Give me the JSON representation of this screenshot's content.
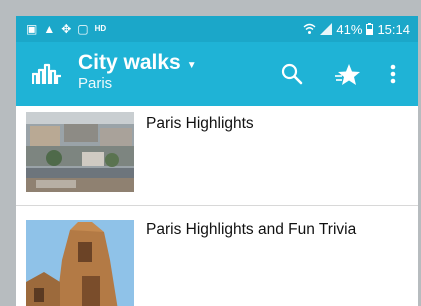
{
  "status_bar": {
    "left_icons": [
      "notification-icon",
      "warning-icon",
      "usb-icon",
      "image-icon",
      "hd-icon"
    ],
    "left_glyphs": [
      "▣",
      "▲",
      "✥",
      "▢",
      "HD"
    ],
    "battery": "41%",
    "time": "15:14"
  },
  "app_bar": {
    "title": "City walks",
    "subtitle": "Paris",
    "colors": {
      "bar": "#1fb3d6",
      "status": "#1ba7c9"
    }
  },
  "tours": [
    {
      "title": "Paris Highlights"
    },
    {
      "title": "Paris Highlights and Fun Trivia"
    }
  ]
}
